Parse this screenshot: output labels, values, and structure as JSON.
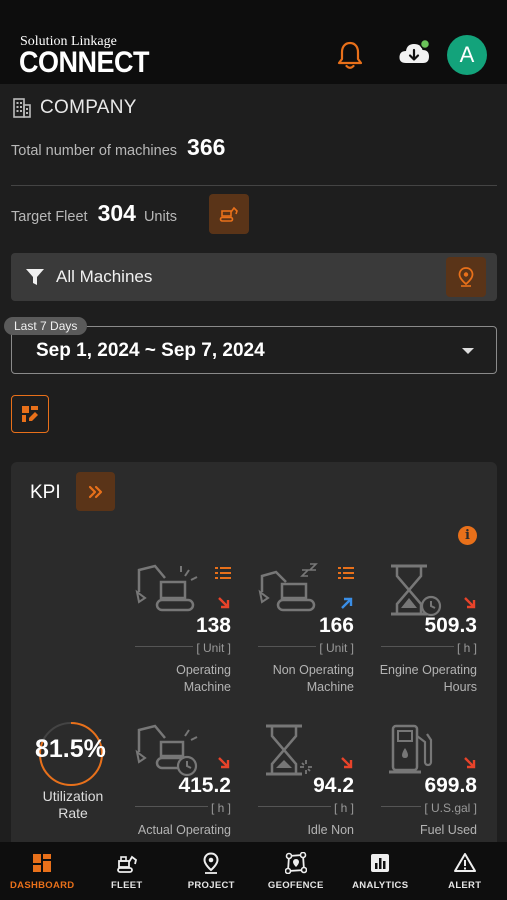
{
  "brand": {
    "line1": "Solution Linkage",
    "line2": "CONNECT"
  },
  "header": {
    "avatar_letter": "A",
    "cloud_status_color": "#6ac259"
  },
  "colors": {
    "accent": "#e8701a",
    "avatar": "#13a37b",
    "up_arrow": "#3a8ee6",
    "down_arrow": "#e8432a"
  },
  "company": {
    "label": "COMPANY"
  },
  "summary": {
    "total_label": "Total number of machines",
    "total_value": "366",
    "target_label": "Target Fleet",
    "target_value": "304",
    "target_unit": "Units"
  },
  "filter": {
    "label": "All Machines"
  },
  "date": {
    "chip": "Last 7 Days",
    "range": "Sep 1, 2024 ~ Sep 7, 2024"
  },
  "kpi": {
    "title": "KPI",
    "utilization": {
      "value": "81.5%",
      "label_line1": "Utilization",
      "label_line2": "Rate",
      "fraction": 0.815
    },
    "metrics": [
      {
        "value": "138",
        "unit": "[ Unit ]",
        "name1": "Operating",
        "name2": "Machine",
        "trend": "down",
        "icon": "excavator-icon"
      },
      {
        "value": "166",
        "unit": "[ Unit ]",
        "name1": "Non Operating",
        "name2": "Machine",
        "trend": "up",
        "icon": "sleeping-excavator-icon"
      },
      {
        "value": "509.3",
        "unit": "[ h ]",
        "name1": "Engine Operating",
        "name2": "Hours",
        "trend": "down",
        "icon": "hourglass-clock-icon"
      },
      {
        "value": "415.2",
        "unit": "[ h ]",
        "name1": "Actual Operating",
        "name2": "",
        "trend": "down",
        "icon": "excavator-clock-icon"
      },
      {
        "value": "94.2",
        "unit": "[ h ]",
        "name1": "Idle Non",
        "name2": "",
        "trend": "down",
        "icon": "hourglass-idle-icon"
      },
      {
        "value": "699.8",
        "unit": "[ U.S.gal ]",
        "name1": "Fuel Used",
        "name2": "",
        "trend": "down",
        "icon": "fuel-pump-icon"
      }
    ]
  },
  "nav": [
    {
      "label": "DASHBOARD",
      "icon": "dashboard-icon"
    },
    {
      "label": "FLEET",
      "icon": "fleet-icon"
    },
    {
      "label": "PROJECT",
      "icon": "project-pin-icon"
    },
    {
      "label": "GEOFENCE",
      "icon": "geofence-icon"
    },
    {
      "label": "ANALYTICS",
      "icon": "analytics-icon"
    },
    {
      "label": "ALERT",
      "icon": "alert-icon"
    }
  ]
}
